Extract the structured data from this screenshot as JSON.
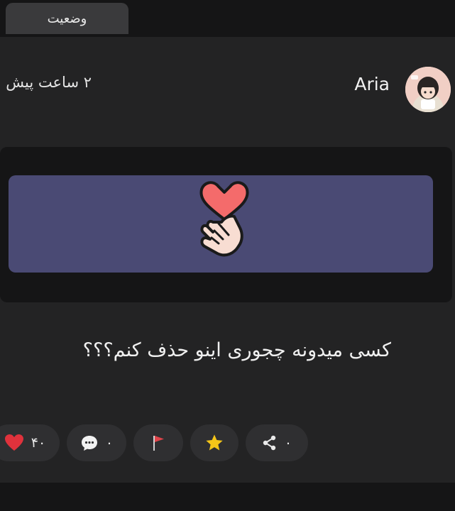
{
  "top_tab": {
    "label": "وضعیت"
  },
  "post": {
    "author": "Aria",
    "time_ago": "۲ ساعت پیش",
    "text": "کسی میدونه چجوری اینو حذف کنم؟؟؟"
  },
  "actions": {
    "share_count": "۰",
    "comment_count": "۰",
    "like_count": "۴۰"
  },
  "icons": {
    "banner": "finger-heart-icon",
    "share": "share-icon",
    "star": "star-icon",
    "flag": "flag-icon",
    "comment": "comment-bubble-icon",
    "like": "heart-icon"
  },
  "colors": {
    "background": "#1b1b1c",
    "card": "#232324",
    "banner": "#4a4a74",
    "like": "#e0323c",
    "flag": "#e0444a",
    "star": "#f5c518"
  }
}
